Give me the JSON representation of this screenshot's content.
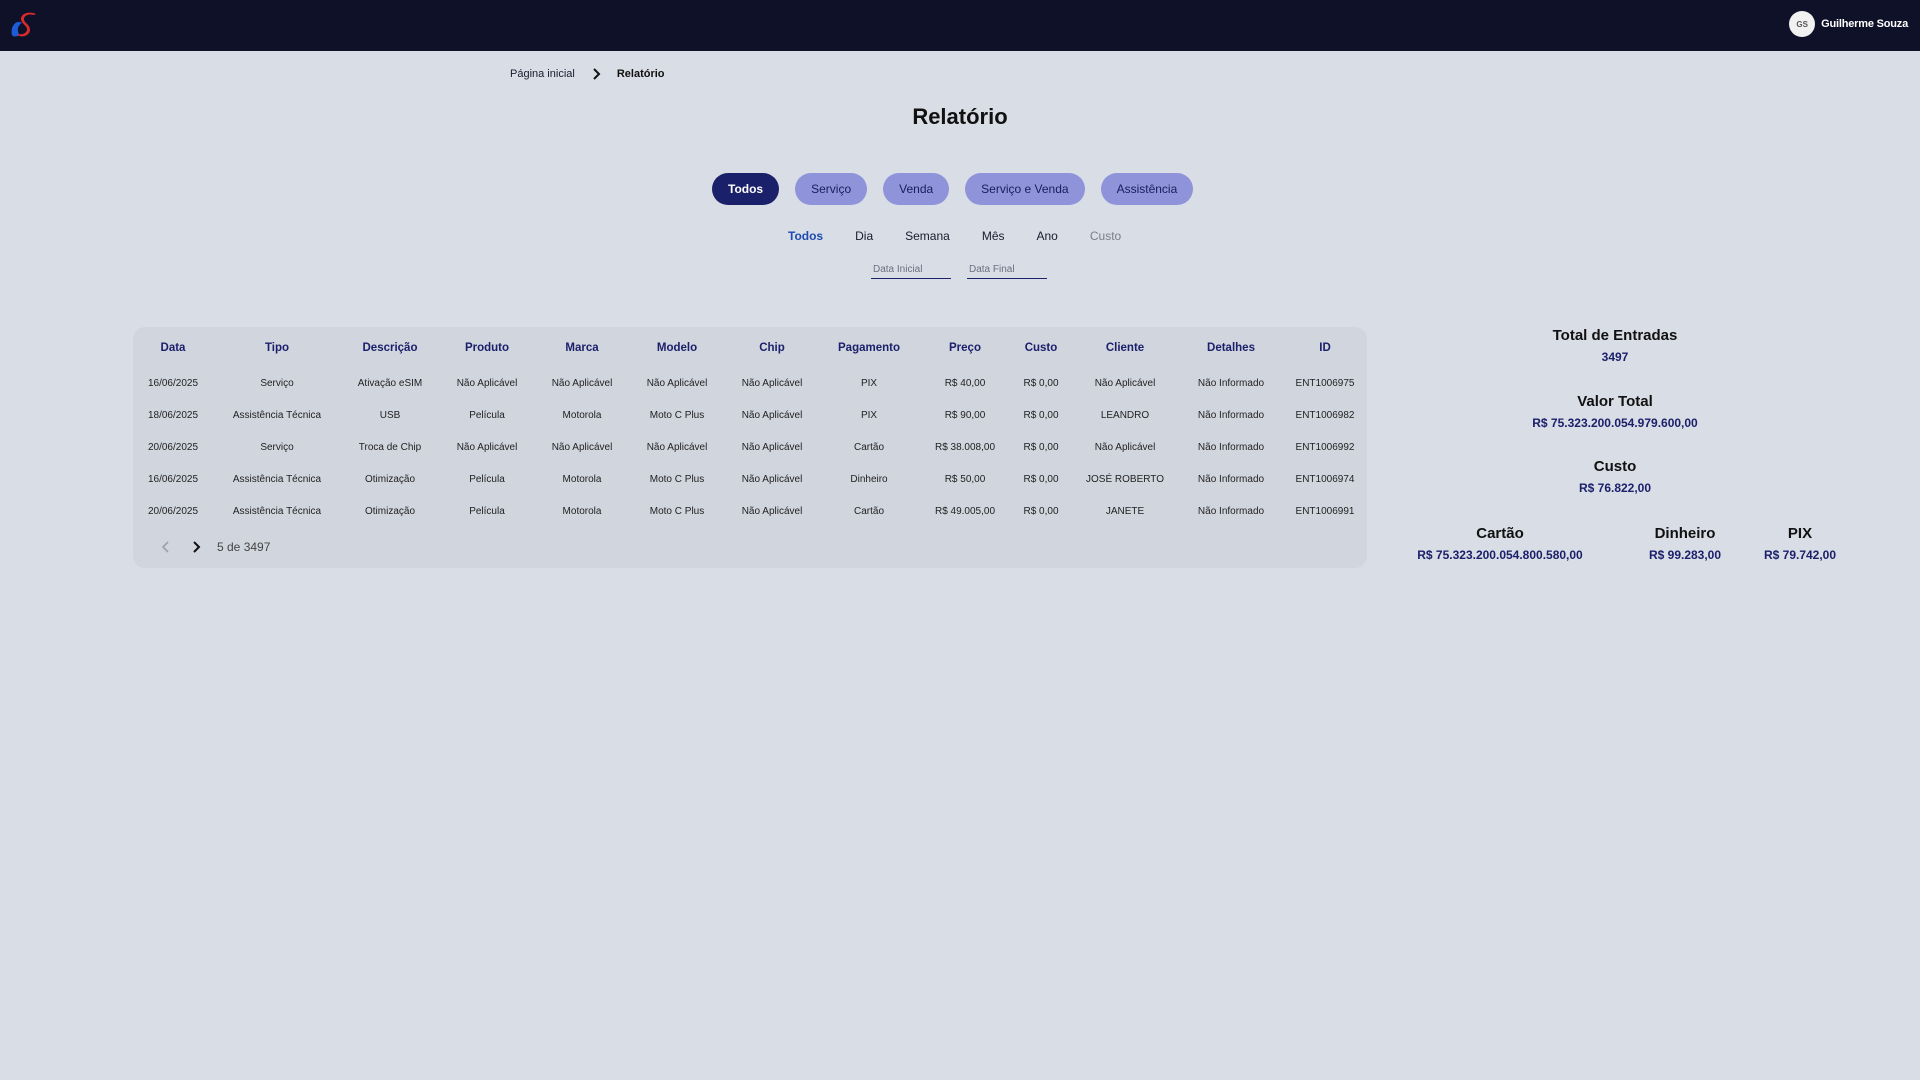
{
  "header": {
    "user_initials": "GS",
    "user_name": "Guilherme Souza",
    "brand_colors": {
      "bar": "#0e1128",
      "logo_blue": "#1e5bd8",
      "logo_red": "#d92b2b"
    }
  },
  "breadcrumb": {
    "home": "Página inicial",
    "current": "Relatório"
  },
  "page": {
    "title": "Relatório"
  },
  "type_filters": [
    {
      "label": "Todos",
      "active": true
    },
    {
      "label": "Serviço",
      "active": false
    },
    {
      "label": "Venda",
      "active": false
    },
    {
      "label": "Serviço e Venda",
      "active": false
    },
    {
      "label": "Assistência",
      "active": false
    }
  ],
  "period_filters": [
    {
      "label": "Todos",
      "active": true
    },
    {
      "label": "Dia",
      "active": false
    },
    {
      "label": "Semana",
      "active": false
    },
    {
      "label": "Mês",
      "active": false
    },
    {
      "label": "Ano",
      "active": false
    },
    {
      "label": "Custo",
      "active": false
    }
  ],
  "date_inputs": {
    "start_placeholder": "Data Inicial",
    "end_placeholder": "Data Final"
  },
  "table": {
    "columns": [
      "Data",
      "Tipo",
      "Descrição",
      "Produto",
      "Marca",
      "Modelo",
      "Chip",
      "Pagamento",
      "Preço",
      "Custo",
      "Cliente",
      "Detalhes",
      "ID"
    ],
    "rows": [
      [
        "16/06/2025",
        "Serviço",
        "Ativação eSIM",
        "Não Aplicável",
        "Não Aplicável",
        "Não Aplicável",
        "Não Aplicável",
        "PIX",
        "R$ 40,00",
        "R$ 0,00",
        "Não Aplicável",
        "Não Informado",
        "ENT1006975"
      ],
      [
        "18/06/2025",
        "Assistência Técnica",
        "USB",
        "Película",
        "Motorola",
        "Moto C Plus",
        "Não Aplicável",
        "PIX",
        "R$ 90,00",
        "R$ 0,00",
        "LEANDRO",
        "Não Informado",
        "ENT1006982"
      ],
      [
        "20/06/2025",
        "Serviço",
        "Troca de Chip",
        "Não Aplicável",
        "Não Aplicável",
        "Não Aplicável",
        "Não Aplicável",
        "Cartão",
        "R$ 38.008,00",
        "R$ 0,00",
        "Não Aplicável",
        "Não Informado",
        "ENT1006992"
      ],
      [
        "16/06/2025",
        "Assistência Técnica",
        "Otimização",
        "Película",
        "Motorola",
        "Moto C Plus",
        "Não Aplicável",
        "Dinheiro",
        "R$ 50,00",
        "R$ 0,00",
        "JOSÉ ROBERTO",
        "Não Informado",
        "ENT1006974"
      ],
      [
        "20/06/2025",
        "Assistência Técnica",
        "Otimização",
        "Película",
        "Motorola",
        "Moto C Plus",
        "Não Aplicável",
        "Cartão",
        "R$ 49.005,00",
        "R$ 0,00",
        "JANETE",
        "Não Informado",
        "ENT1006991"
      ]
    ],
    "pagination": "5 de 3497"
  },
  "summary": {
    "total_entries_label": "Total de Entradas",
    "total_entries_value": "3497",
    "total_value_label": "Valor Total",
    "total_value_value": "R$ 75.323.200.054.979.600,00",
    "cost_label": "Custo",
    "cost_value": "R$ 76.822,00",
    "payments": [
      {
        "label": "Cartão",
        "value": "R$ 75.323.200.054.800.580,00"
      },
      {
        "label": "Dinheiro",
        "value": "R$ 99.283,00"
      },
      {
        "label": "PIX",
        "value": "R$ 79.742,00"
      }
    ]
  }
}
